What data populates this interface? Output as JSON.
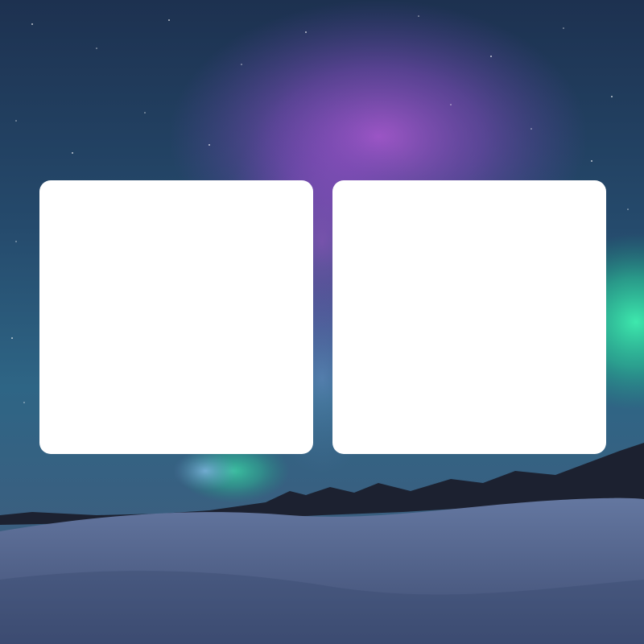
{
  "background": {
    "scene": "aurora-night-sky-over-snowy-field",
    "colors": {
      "sky_dark": "#1f3552",
      "sky_mid": "#2f5f80",
      "aurora_purple": "#a04fcf",
      "aurora_green": "#2fe0a0",
      "snow": "#5b6f98",
      "snow_dark": "#3f4d72",
      "trees": "#1e2230"
    }
  },
  "cards": [
    {
      "background": "#ffffff"
    },
    {
      "background": "#ffffff"
    }
  ]
}
